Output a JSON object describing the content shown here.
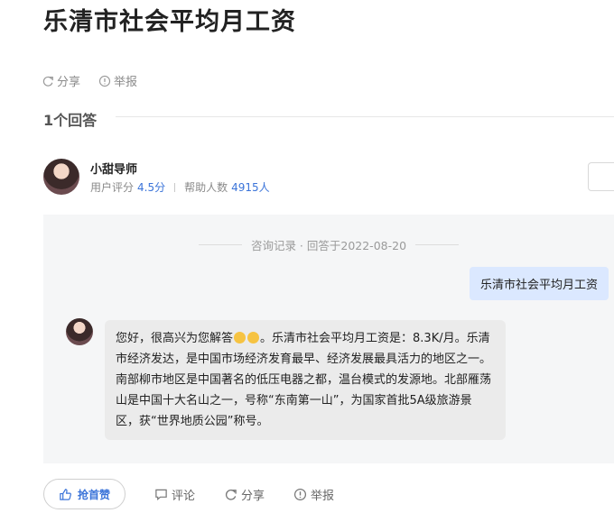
{
  "question": {
    "title": "乐清市社会平均月工资",
    "actions": [
      "分享",
      "举报"
    ]
  },
  "answers_header": "1个回答",
  "answerer": {
    "name": "小甜导师",
    "rating_label": "用户评分",
    "rating_value": "4.5分",
    "helped_label": "帮助人数",
    "helped_value": "4915人"
  },
  "consultation": {
    "record_label": "咨询记录 · 回答于2022-08-20",
    "user_question": "乐清市社会平均月工资",
    "answer_before_emoji": "您好，很高兴为您解答",
    "answer_after_emoji": "。乐清市社会平均月工资是：8.3K/月。乐清市经济发达，是中国市场经济发育最早、经济发展最具活力的地区之一。南部柳市地区是中国著名的低压电器之都，温台模式的发源地。北部雁荡山是中国十大名山之一，号称“东南第一山”，为国家首批5A级旅游景区，获“世界地质公园”称号。"
  },
  "bottom_actions": {
    "like": "抢首赞",
    "comment": "评论",
    "share": "分享",
    "report": "举报"
  },
  "colors": {
    "accent": "#3b74d9",
    "question_bubble": "#dbe8ff",
    "panel_bg": "#f5f6f7"
  }
}
